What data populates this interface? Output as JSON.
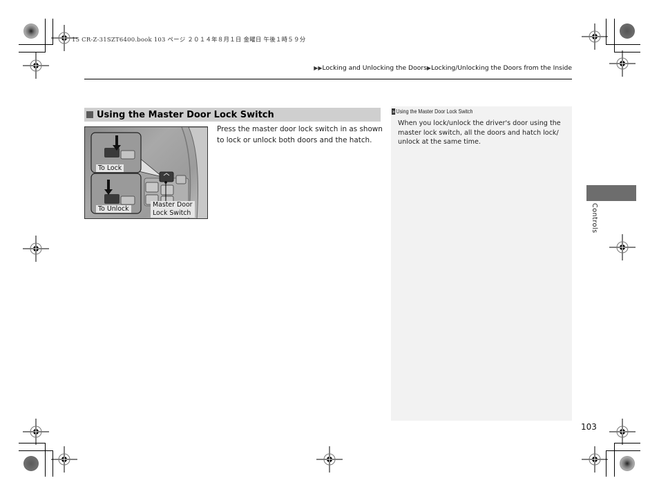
{
  "print_header": "15 CR-Z-31SZT6400.book  103 ページ  ２０１４年８月１日  金曜日  午後１時５９分",
  "breadcrumb": {
    "prefix_icon": "double-triangle-icon",
    "items": [
      "Locking and Unlocking the Doors",
      "Locking/Unlocking the Doors from the Inside"
    ],
    "separator_icon": "triangle-icon"
  },
  "section": {
    "icon": "square-bullet-icon",
    "title": "Using the Master Door Lock Switch",
    "body": "Press the master door lock switch in as shown to lock or unlock both doors and the hatch."
  },
  "figure": {
    "labels": {
      "to_lock": "To Lock",
      "to_unlock": "To Unlock",
      "master_switch": "Master Door\nLock Switch"
    }
  },
  "note": {
    "icon": "double-chevron-icon",
    "title": "Using the Master Door Lock Switch",
    "body": "When you lock/unlock the driver's door using the master lock switch, all the doors and hatch lock/ unlock at the same time."
  },
  "side_tab": {
    "label": "Controls",
    "color": "#6d6d6d"
  },
  "page_number": "103",
  "colors": {
    "section_bar": "#cfcfcf",
    "note_background": "#f2f2f2",
    "rule": "#000000"
  }
}
